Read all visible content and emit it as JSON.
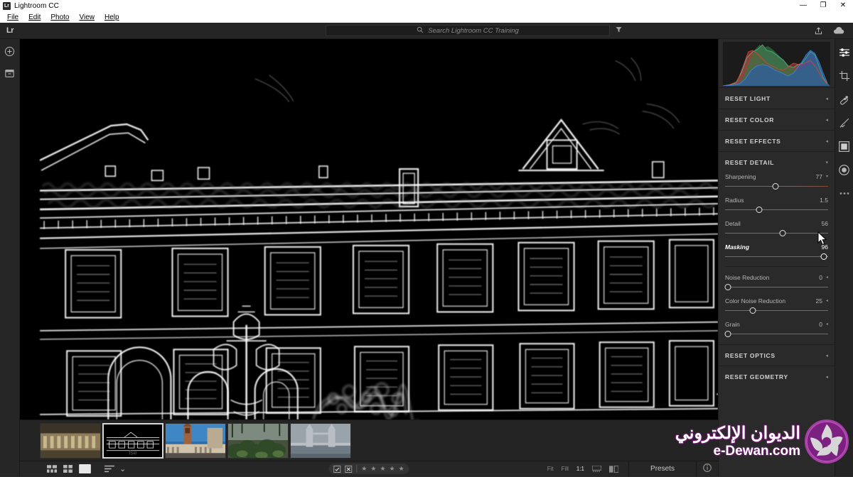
{
  "window": {
    "app_icon": "lr",
    "title": "Lightroom CC",
    "controls": {
      "minimize": "—",
      "maximize": "❐",
      "close": "✕"
    }
  },
  "menubar": {
    "items": [
      {
        "label": "File",
        "mnemonic": "F"
      },
      {
        "label": "Edit",
        "mnemonic": "E"
      },
      {
        "label": "Photo",
        "mnemonic": "P"
      },
      {
        "label": "View",
        "mnemonic": "V"
      },
      {
        "label": "Help",
        "mnemonic": "H"
      }
    ]
  },
  "topbar": {
    "logo": "Lr",
    "search": {
      "placeholder": "Search Lightroom CC Training",
      "value": "",
      "icon": "search-icon"
    },
    "filter_icon": "filter-icon",
    "share_icon": "share-icon",
    "cloud_icon": "cloud-icon"
  },
  "leftrail": {
    "items": [
      {
        "name": "add-photos-button",
        "icon": "plus-circle-icon"
      },
      {
        "name": "library-button",
        "icon": "archive-box-icon"
      }
    ]
  },
  "rightrail": {
    "tools": [
      {
        "name": "edit-tool",
        "icon": "sliders-icon",
        "selected": true
      },
      {
        "name": "crop-tool",
        "icon": "crop-icon",
        "selected": false
      },
      {
        "name": "healing-tool",
        "icon": "healing-brush-icon",
        "selected": false
      },
      {
        "name": "brush-tool",
        "icon": "paint-brush-icon",
        "selected": false
      },
      {
        "name": "linear-gradient-tool",
        "icon": "gradient-rect-icon",
        "selected": false
      },
      {
        "name": "radial-gradient-tool",
        "icon": "radial-circle-icon",
        "selected": false
      },
      {
        "name": "more-tools",
        "icon": "ellipsis-icon",
        "selected": false
      }
    ]
  },
  "panel": {
    "histogram": {
      "name": "histogram",
      "label": "Histogram"
    },
    "sections": [
      {
        "id": "light",
        "title": "RESET LIGHT",
        "expanded": false,
        "caret": "◂"
      },
      {
        "id": "color",
        "title": "RESET COLOR",
        "expanded": false,
        "caret": "◂"
      },
      {
        "id": "effects",
        "title": "RESET EFFECTS",
        "expanded": false,
        "caret": "◂"
      },
      {
        "id": "detail",
        "title": "RESET DETAIL",
        "expanded": true,
        "caret": "▾"
      }
    ],
    "bottom_sections": [
      {
        "id": "optics",
        "title": "RESET OPTICS",
        "expanded": false,
        "caret": "◂"
      },
      {
        "id": "geometry",
        "title": "RESET GEOMETRY",
        "expanded": false,
        "caret": "◂"
      }
    ],
    "detail_sliders": [
      {
        "name": "Sharpening",
        "value": "77",
        "pct": 49,
        "caret": "▾",
        "active": false,
        "warm": true
      },
      {
        "name": "Radius",
        "value": "1.5",
        "pct": 33,
        "caret": "",
        "active": false,
        "warm": false
      },
      {
        "name": "Detail",
        "value": "56",
        "pct": 56,
        "caret": "",
        "active": false,
        "warm": false
      },
      {
        "name": "Masking",
        "value": "96",
        "pct": 96,
        "caret": "",
        "active": true,
        "warm": false
      }
    ],
    "noise_sliders": [
      {
        "name": "Noise Reduction",
        "value": "0",
        "pct": 3,
        "caret": "◂",
        "active": false,
        "warm": false
      },
      {
        "name": "Color Noise Reduction",
        "value": "25",
        "pct": 27,
        "caret": "◂",
        "active": false,
        "warm": false
      },
      {
        "name": "Grain",
        "value": "0",
        "pct": 3,
        "caret": "◂",
        "active": false,
        "warm": false
      }
    ]
  },
  "filmstrip": {
    "thumbs": [
      {
        "name": "thumb-colonnade-building",
        "selected": false
      },
      {
        "name": "thumb-mask-overlay-edges",
        "selected": true
      },
      {
        "name": "thumb-st-marks-campanile",
        "selected": false
      },
      {
        "name": "thumb-green-foliage",
        "selected": false
      },
      {
        "name": "thumb-tower-bridge",
        "selected": false
      }
    ]
  },
  "bottombar": {
    "view_modes": [
      {
        "name": "grid-detail-view-button",
        "icon": "grid-detail-icon"
      },
      {
        "name": "grid-view-button",
        "icon": "grid-icon"
      },
      {
        "name": "detail-view-button",
        "icon": "square-icon",
        "selected": true
      }
    ],
    "sort_button": {
      "name": "sort-button",
      "icon": "sort-lines-icon",
      "caret": "⌄"
    },
    "flags": [
      {
        "name": "flag-pick-button",
        "icon": "flag-check-icon"
      },
      {
        "name": "flag-reject-button",
        "icon": "flag-reject-icon"
      }
    ],
    "stars": {
      "count": 5,
      "filled": 0,
      "glyph": "★"
    },
    "zoom_levels": [
      {
        "label": "Fit",
        "active": false
      },
      {
        "label": "Fill",
        "active": false
      },
      {
        "label": "1:1",
        "active": true
      },
      {
        "label": "",
        "active": false,
        "icon": "zoom-dots-icon"
      },
      {
        "label": "",
        "active": false,
        "icon": "compare-icon"
      }
    ],
    "presets_label": "Presets",
    "info_icon": "info-icon"
  },
  "watermark": {
    "arabic": "الديوان الإلكتروني",
    "latin": "e-Dewan.com",
    "color": "#8d2a8d"
  },
  "colors": {
    "panel_bg": "#2a2a2a",
    "app_bg": "#2b2b2b",
    "canvas_bg": "#000000",
    "accent": "#e3e3e3",
    "text": "#b6b6b6"
  }
}
